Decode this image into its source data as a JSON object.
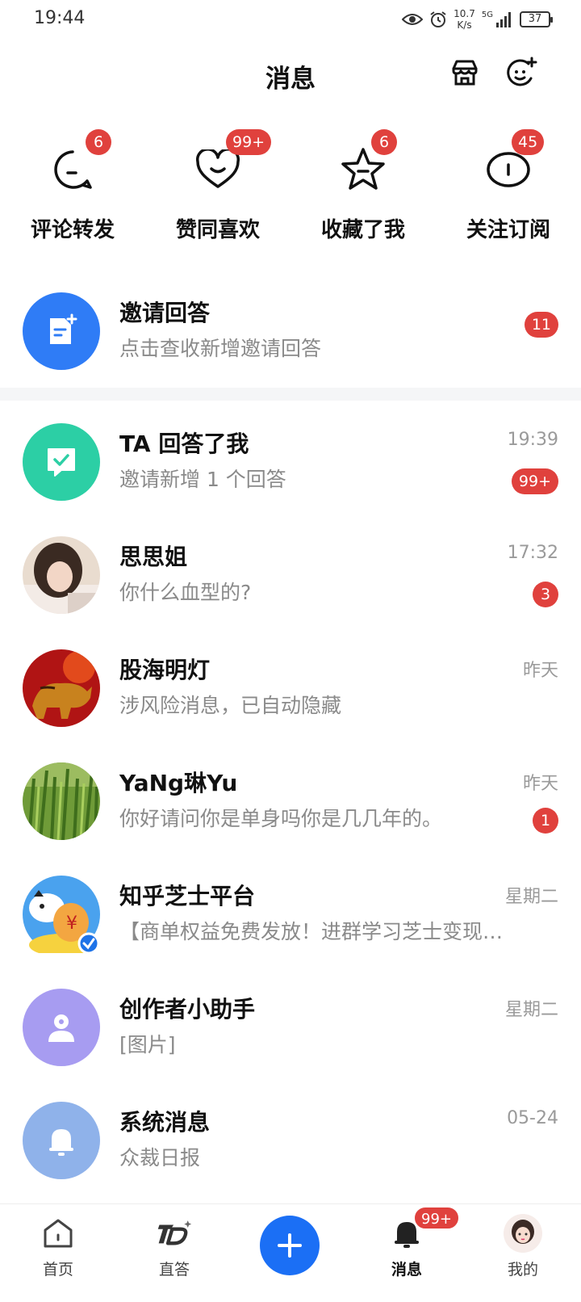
{
  "status_bar": {
    "time": "19:44",
    "net_speed_value": "10.7",
    "net_speed_unit": "K/s",
    "network": "5G",
    "battery": "37"
  },
  "header": {
    "title": "消息",
    "icons": [
      "shop-icon",
      "add-chat-icon"
    ]
  },
  "quick_actions": [
    {
      "label": "评论转发",
      "badge": "6",
      "icon": "comment-icon"
    },
    {
      "label": "赞同喜欢",
      "badge": "99+",
      "icon": "heart-icon"
    },
    {
      "label": "收藏了我",
      "badge": "6",
      "icon": "star-icon"
    },
    {
      "label": "关注订阅",
      "badge": "45",
      "icon": "follow-icon"
    }
  ],
  "invite": {
    "title": "邀请回答",
    "subtitle": "点击查收新增邀请回答",
    "badge": "11",
    "icon": "invite-doc-icon",
    "color": "#2f7cf6"
  },
  "conversations": [
    {
      "name": "TA 回答了我",
      "preview": "邀请新增 1 个回答",
      "time": "19:39",
      "badge": "99+",
      "avatar": "answer-check-icon",
      "color": "#2ccfa5"
    },
    {
      "name": "思思姐",
      "preview": "你什么血型的?",
      "time": "17:32",
      "badge": "3",
      "avatar": "user-photo-girl"
    },
    {
      "name": "股海明灯",
      "preview": "涉风险消息，已自动隐藏",
      "time": "昨天",
      "badge": "",
      "avatar": "user-photo-bull"
    },
    {
      "name": "YaNg琳Yu",
      "preview": "你好请问你是单身吗你是几几年的。",
      "time": "昨天",
      "badge": "1",
      "avatar": "user-photo-grass"
    },
    {
      "name": "知乎芝士平台",
      "preview": "【商单权益免费发放！进群学习芝士变现…",
      "time": "星期二",
      "badge": "",
      "avatar": "zhihu-cheese-mascot"
    },
    {
      "name": "创作者小助手",
      "preview": "[图片]",
      "time": "星期二",
      "badge": "",
      "avatar": "creator-person-icon",
      "color": "#a79cf1"
    },
    {
      "name": "系统消息",
      "preview": "众裁日报",
      "time": "05-24",
      "badge": "",
      "avatar": "bell-icon",
      "color": "#8fb2ea"
    }
  ],
  "bottom_nav": [
    {
      "label": "首页",
      "icon": "home-icon"
    },
    {
      "label": "直答",
      "icon": "zhida-logo-icon"
    },
    {
      "label": "",
      "icon": "plus-icon"
    },
    {
      "label": "消息",
      "icon": "message-bell-icon",
      "badge": "99+",
      "active": true
    },
    {
      "label": "我的",
      "icon": "profile-avatar"
    }
  ],
  "colors": {
    "badge": "#e0413d",
    "primary": "#1b6ff5"
  }
}
